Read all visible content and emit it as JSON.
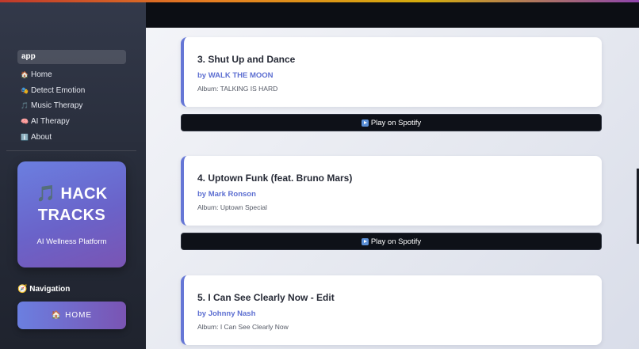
{
  "sidebar": {
    "active_label": "app",
    "items": [
      {
        "icon": "🏠",
        "label": "Home"
      },
      {
        "icon": "🎭",
        "label": "Detect Emotion"
      },
      {
        "icon": "🎵",
        "label": "Music Therapy"
      },
      {
        "icon": "🧠",
        "label": "AI Therapy"
      },
      {
        "icon": "ℹ️",
        "label": "About"
      }
    ],
    "brand": {
      "title_line1": "🎵 HACK",
      "title_line2": "TRACKS",
      "subtitle": "AI Wellness Platform"
    },
    "nav_heading": "🧭 Navigation",
    "home_button": "🏠 HOME"
  },
  "tracks": [
    {
      "title": "3. Shut Up and Dance",
      "artist": "by WALK THE MOON",
      "album": "Album: TALKING IS HARD",
      "button": "Play on Spotify"
    },
    {
      "title": "4. Uptown Funk (feat. Bruno Mars)",
      "artist": "by Mark Ronson",
      "album": "Album: Uptown Special",
      "button": "Play on Spotify"
    },
    {
      "title": "5. I Can See Clearly Now - Edit",
      "artist": "by Johnny Nash",
      "album": "Album: I Can See Clearly Now"
    }
  ],
  "colors": {
    "accent": "#6677d6",
    "brand_gradient_start": "#6b7fe0",
    "brand_gradient_end": "#7a54b3",
    "sidebar_bg": "#2b3040",
    "button_bg": "#0e1118"
  }
}
